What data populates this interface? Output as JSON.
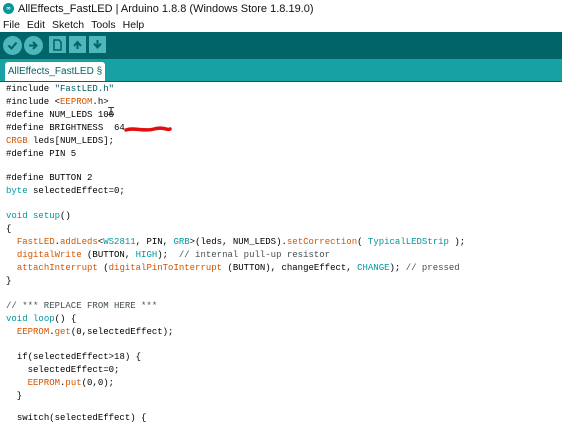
{
  "window": {
    "title": "AllEffects_FastLED | Arduino 1.8.8 (Windows Store 1.8.19.0)",
    "logo_text": "∞"
  },
  "menu": [
    "File",
    "Edit",
    "Sketch",
    "Tools",
    "Help"
  ],
  "toolbar": {
    "buttons": [
      "verify-icon",
      "upload-icon",
      "new-icon",
      "open-icon",
      "save-icon"
    ]
  },
  "tab": {
    "label": "AllEffects_FastLED §"
  },
  "code": {
    "l1": {
      "a": "#include ",
      "b": "\"FastLED.h\""
    },
    "l2": {
      "a": "#include <",
      "b": "EEPROM",
      "c": ".h>"
    },
    "l3": "#define NUM_LEDS 100",
    "l4": "#define BRIGHTNESS  64",
    "l5": {
      "a": "CRGB",
      "b": " leds[NUM_LEDS];"
    },
    "l6": "#define PIN 5",
    "l8": "#define BUTTON 2",
    "l9": {
      "a": "byte",
      "b": " selectedEffect=0;"
    },
    "l11": {
      "a": "void",
      "b": " ",
      "c": "setup",
      "d": "()"
    },
    "l12": "{",
    "l13": {
      "a": "  ",
      "b": "FastLED",
      "c": ".",
      "d": "addLeds",
      "e": "<",
      "f": "WS2811",
      "g": ", PIN, ",
      "h": "GRB",
      "i": ">(leds, NUM_LEDS).",
      "j": "setCorrection",
      "k": "( ",
      "l": "TypicalLEDStrip",
      "m": " );"
    },
    "l14": {
      "a": "  ",
      "b": "digitalWrite",
      "c": " (BUTTON, ",
      "d": "HIGH",
      "e": ");  ",
      "f": "// internal pull-up resistor"
    },
    "l15": {
      "a": "  ",
      "b": "attachInterrupt",
      "c": " (",
      "d": "digitalPinToInterrupt",
      "e": " (BUTTON), changeEffect, ",
      "f": "CHANGE",
      "g": "); ",
      "h": "// pressed"
    },
    "l16": "}",
    "l18": "// *** REPLACE FROM HERE ***",
    "l19": {
      "a": "void",
      "b": " ",
      "c": "loop",
      "d": "() {"
    },
    "l20": {
      "a": "  ",
      "b": "EEPROM",
      "c": ".",
      "d": "get",
      "e": "(0,selectedEffect);"
    },
    "l22": {
      "a": "  ",
      "b": "if",
      "c": "(selectedEffect>18) {"
    },
    "l23": "    selectedEffect=0;",
    "l24": {
      "a": "    ",
      "b": "EEPROM",
      "c": ".",
      "d": "put",
      "e": "(0,0);"
    },
    "l25": "  }",
    "l27": {
      "a": "  ",
      "b": "switch",
      "c": "(selectedEffect) {"
    }
  },
  "colors": {
    "toolbar": "#006468",
    "tabstrip": "#17a1a5",
    "keyword": "#00979d",
    "library": "#d35400",
    "scribble": "#e01010"
  }
}
